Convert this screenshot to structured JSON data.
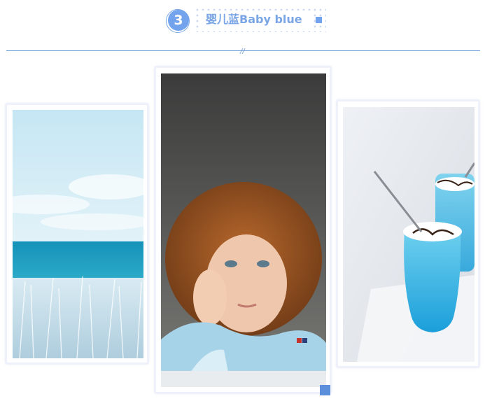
{
  "header": {
    "number": "3",
    "title": "婴儿蓝Baby blue"
  },
  "decor": {
    "slash": "//"
  },
  "photos": [
    {
      "name": "ocean-seascape"
    },
    {
      "name": "red-haired-child"
    },
    {
      "name": "blue-drinks"
    }
  ],
  "colors": {
    "accent": "#72a3ec",
    "line": "#6f9fd8",
    "dots": "#cbd9f7",
    "corner": "#5b8fdc"
  }
}
